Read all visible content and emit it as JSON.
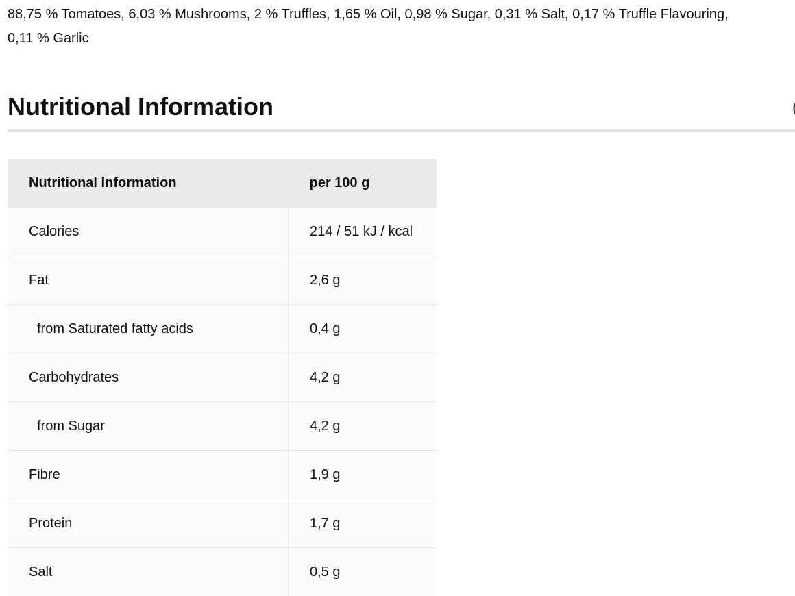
{
  "ingredients": {
    "line1": "88,75 % Tomatoes, 6,03 % Mushrooms, 2 % Truffles, 1,65 % Oil, 0,98 % Sugar, 0,31 % Salt, 0,17 % Truffle Flavouring,",
    "line2": "0,11 % Garlic"
  },
  "section": {
    "title": "Nutritional Information"
  },
  "table": {
    "headers": [
      "Nutritional Information",
      "per 100 g"
    ],
    "rows": [
      {
        "label": "Calories",
        "value": "214 / 51 kJ / kcal",
        "indent": false
      },
      {
        "label": "Fat",
        "value": "2,6 g",
        "indent": false
      },
      {
        "label": "from Saturated fatty acids",
        "value": "0,4 g",
        "indent": true
      },
      {
        "label": "Carbohydrates",
        "value": "4,2 g",
        "indent": false
      },
      {
        "label": "from Sugar",
        "value": "4,2 g",
        "indent": true
      },
      {
        "label": "Fibre",
        "value": "1,9 g",
        "indent": false
      },
      {
        "label": "Protein",
        "value": "1,7 g",
        "indent": false
      },
      {
        "label": "Salt",
        "value": "0,5 g",
        "indent": false
      }
    ]
  }
}
